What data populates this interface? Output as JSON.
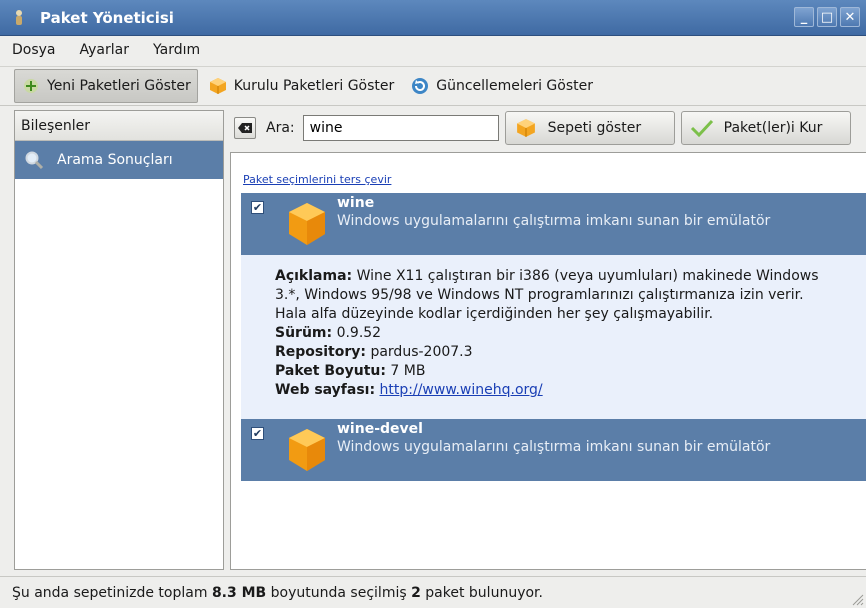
{
  "window": {
    "title": "Paket Yöneticisi",
    "minimize": "_",
    "maximize": "□",
    "close": "✕"
  },
  "menu": [
    {
      "label": "Dosya"
    },
    {
      "label": "Ayarlar"
    },
    {
      "label": "Yardım"
    }
  ],
  "toolbar": {
    "new_packages": "Yeni Paketleri Göster",
    "installed_packages": "Kurulu Paketleri Göster",
    "updates": "Güncellemeleri Göster"
  },
  "sidebar": {
    "header": "Bileşenler",
    "items": [
      {
        "label": "Arama Sonuçları",
        "icon": "magnifier-icon",
        "selected": true
      }
    ]
  },
  "search": {
    "label": "Ara:",
    "value": "wine",
    "show_cart": "Sepeti göster",
    "install": "Paket(ler)i Kur"
  },
  "results": {
    "invert_link": "Paket seçimlerini ters çevir",
    "packages": [
      {
        "name": "wine",
        "summary": "Windows uygulamalarını çalıştırma imkanı sunan bir emülatör",
        "checked": true,
        "check_mark": "✔"
      },
      {
        "name": "wine-devel",
        "summary": "Windows uygulamalarını çalıştırma imkanı sunan bir emülatör",
        "checked": true,
        "check_mark": "✔"
      }
    ],
    "details": {
      "description_label": "Açıklama:",
      "description": "Wine X11 çalıştıran bir i386 (veya uyumluları) makinede Windows 3.*, Windows 95/98 ve Windows NT programlarınızı çalıştırmanıza izin verir. Hala alfa düzeyinde kodlar içerdiğinden her şey çalışmayabilir.",
      "version_label": "Sürüm:",
      "version": "0.9.52",
      "repository_label": "Repository:",
      "repository": "pardus-2007.3",
      "size_label": "Paket Boyutu:",
      "size": "7 MB",
      "website_label": "Web sayfası:",
      "website": "http://www.winehq.org/"
    }
  },
  "status": {
    "prefix": "Şu anda sepetinizde toplam",
    "total_size": "8.3 MB",
    "middle": "boyutunda seçilmiş",
    "count": "2",
    "suffix": "paket bulunuyor."
  },
  "colors": {
    "selection": "#5b7ea8",
    "titlebar": "#4a76ae",
    "details_bg": "#eaf0fb"
  }
}
